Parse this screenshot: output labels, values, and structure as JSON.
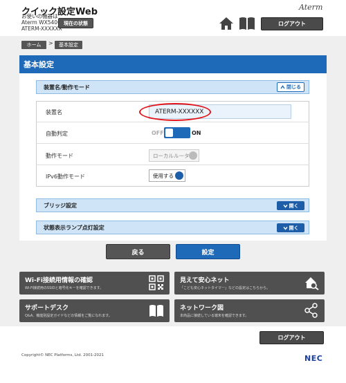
{
  "header": {
    "title": "クイック設定Web",
    "device_lines": [
      "お使いの機器は",
      "Aterm WX5400HP",
      "ATERM-XXXXXX"
    ],
    "status_button": "現在の状態",
    "brand": "Aterm",
    "logout": "ログアウト"
  },
  "breadcrumb": {
    "items": [
      "ホーム",
      "基本設定"
    ],
    "separator": ">"
  },
  "main": {
    "section_title": "基本設定",
    "accordion_device": {
      "title": "装置名/動作モード",
      "close_label": "閉じる"
    },
    "rows": [
      {
        "label": "装置名",
        "value": "ATERM-XXXXXX"
      },
      {
        "label": "自動判定",
        "off": "OFF",
        "on": "ON"
      },
      {
        "label": "動作モード",
        "value": "ローカルルータ"
      },
      {
        "label": "IPv6動作モード",
        "value": "使用する"
      }
    ],
    "accordion_bridge": {
      "title": "ブリッジ設定",
      "open_label": "開く"
    },
    "accordion_lamp": {
      "title": "状態表示ランプ点灯設定",
      "open_label": "開く"
    },
    "back_button": "戻る",
    "set_button": "設定"
  },
  "tiles": [
    {
      "title": "Wi-Fi接続用情報の確認",
      "desc": "Wi-Fi接続用のSSIDと暗号化キーを確認できます。",
      "icon": "qr-code-icon"
    },
    {
      "title": "見えて安心ネット",
      "desc": "「こども安心ネットタイマー」などの設定はこちらから。",
      "icon": "house-magnifier-icon"
    },
    {
      "title": "サポートデスク",
      "desc": "Q&A、機能別設定ガイドなどの情報をご覧になれます。",
      "icon": "book-icon"
    },
    {
      "title": "ネットワーク図",
      "desc": "本商品に接続している端末を確認できます。",
      "icon": "network-icon"
    }
  ],
  "footer": {
    "logout": "ログアウト",
    "copyright": "Copyright© NEC Platforms, Ltd. 2001-2021",
    "logo": "NEC"
  },
  "colors": {
    "accent": "#1e6ab8",
    "highlight": "#e0141a",
    "dark_button": "#4a4a4a"
  }
}
